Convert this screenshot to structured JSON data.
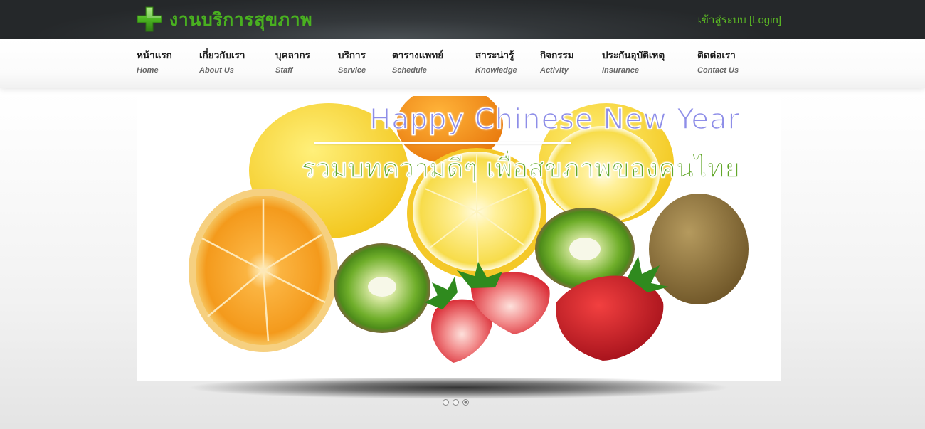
{
  "header": {
    "site_title": "งานบริการสุขภาพ",
    "login_label": "เข้าสู่ระบบ [Login]"
  },
  "nav": {
    "items": [
      {
        "th": "หน้าแรก",
        "en": "Home"
      },
      {
        "th": "เกี่ยวกับเรา",
        "en": "About Us"
      },
      {
        "th": "บุคลากร",
        "en": "Staff"
      },
      {
        "th": "บริการ",
        "en": "Service"
      },
      {
        "th": "ตารางแพทย์",
        "en": "Schedule"
      },
      {
        "th": "สาระน่ารู้",
        "en": "Knowledge"
      },
      {
        "th": "กิจกรรม",
        "en": "Activity"
      },
      {
        "th": "ประกันอุบัติเหตุ",
        "en": "Insurance"
      },
      {
        "th": "ติดต่อเรา",
        "en": "Contact Us"
      }
    ]
  },
  "banner": {
    "title_en": "Happy Chinese New Year",
    "title_th": "รวมบทความดีๆ เพื่อสุขภาพของคนไทย",
    "image": "fruit-image"
  },
  "slider": {
    "slide_count": 3,
    "active_slide": 3
  },
  "colors": {
    "topbar": "#2b2e30",
    "brand_green": "#49b020",
    "login_green": "#5ab624",
    "banner_en": "#8e8ee8",
    "banner_th": "#62a72a"
  }
}
